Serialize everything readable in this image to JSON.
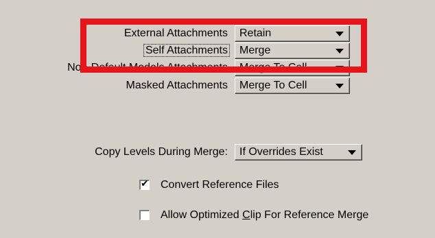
{
  "rows": [
    {
      "label": "External Attachments",
      "value": "Retain"
    },
    {
      "label": "Self Attachments",
      "value": "Merge"
    },
    {
      "label": "Non-Default Models Attachments",
      "value": "Merge To Cell"
    },
    {
      "label": "Masked Attachments",
      "value": "Merge To Cell"
    }
  ],
  "copy_levels": {
    "label": "Copy Levels During Merge:",
    "value": "If Overrides Exist"
  },
  "checkboxes": [
    {
      "label": "Convert Reference Files",
      "checked": true
    },
    {
      "label_pre": "Allow Optimized ",
      "label_underlined": "C",
      "label_post": "lip For Reference Merge",
      "checked": false
    }
  ],
  "colors": {
    "highlight": "#e8141c",
    "dialog_bg": "#d4d0c8"
  },
  "icons": {
    "dropdown": "triangle-down-icon",
    "check": "check-mark-icon"
  }
}
